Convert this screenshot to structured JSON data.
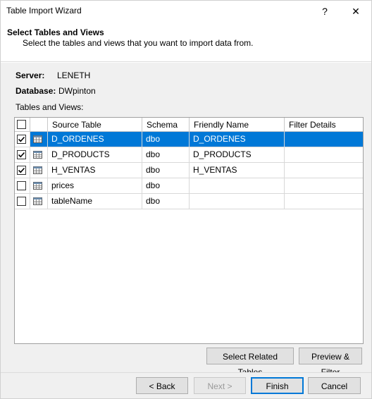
{
  "window": {
    "title": "Table Import Wizard",
    "help_glyph": "?",
    "close_glyph": "✕"
  },
  "header": {
    "title": "Select Tables and Views",
    "subtitle": "Select the tables and views that you want to import data from."
  },
  "connection": {
    "server_label": "Server:",
    "server_value": "LENETH",
    "database_label": "Database:",
    "database_value": "DWpinton",
    "list_label": "Tables and Views:"
  },
  "grid": {
    "columns": [
      "Source Table",
      "Schema",
      "Friendly Name",
      "Filter Details"
    ],
    "rows": [
      {
        "checked": true,
        "source": "D_ORDENES",
        "schema": "dbo",
        "friendly": "D_ORDENES",
        "filter": "",
        "selected": true
      },
      {
        "checked": true,
        "source": "D_PRODUCTS",
        "schema": "dbo",
        "friendly": "D_PRODUCTS",
        "filter": "",
        "selected": false
      },
      {
        "checked": true,
        "source": "H_VENTAS",
        "schema": "dbo",
        "friendly": "H_VENTAS",
        "filter": "",
        "selected": false
      },
      {
        "checked": false,
        "source": "prices",
        "schema": "dbo",
        "friendly": "",
        "filter": "",
        "selected": false
      },
      {
        "checked": false,
        "source": "tableName",
        "schema": "dbo",
        "friendly": "",
        "filter": "",
        "selected": false
      }
    ]
  },
  "actions": {
    "select_related": "Select Related Tables",
    "preview_filter": "Preview & Filter"
  },
  "footer": {
    "back": "< Back",
    "next": "Next >",
    "finish": "Finish",
    "cancel": "Cancel"
  },
  "colors": {
    "selection": "#0078d7",
    "body_bg": "#f0f0f0"
  }
}
